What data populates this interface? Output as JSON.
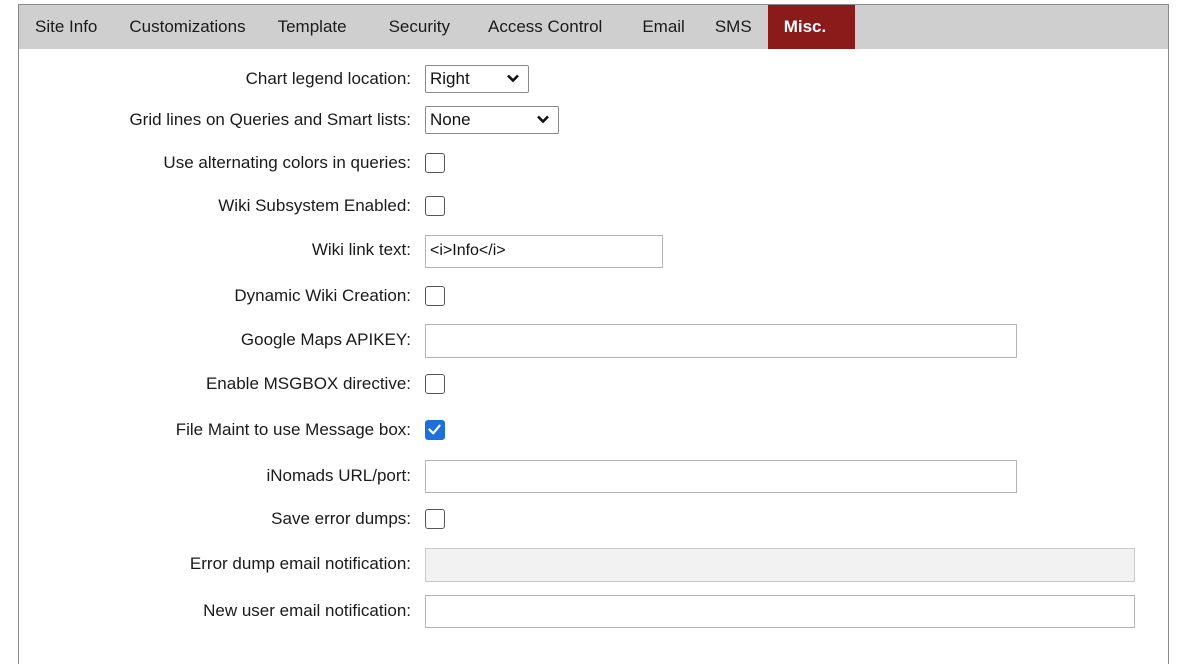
{
  "tabs": [
    {
      "label": "Site Info",
      "active": false
    },
    {
      "label": "Customizations",
      "active": false
    },
    {
      "label": "Template",
      "active": false
    },
    {
      "label": "Security",
      "active": false
    },
    {
      "label": "Access Control",
      "active": false
    },
    {
      "label": "Email",
      "active": false
    },
    {
      "label": "SMS",
      "active": false
    },
    {
      "label": "Misc.",
      "active": true
    }
  ],
  "colors": {
    "tab_bar": "#cfcfcf",
    "active_tab": "#8b1a1a",
    "checkbox_checked": "#1e6fd9"
  },
  "fields": {
    "chart_legend": {
      "label": "Chart legend location:",
      "value": "Right"
    },
    "grid_lines": {
      "label": "Grid lines on Queries and Smart lists:",
      "value": "None"
    },
    "alt_colors": {
      "label": "Use alternating colors in queries:",
      "checked": false
    },
    "wiki_enabled": {
      "label": "Wiki Subsystem Enabled:",
      "checked": false
    },
    "wiki_link_text": {
      "label": "Wiki link text:",
      "value": "<i>Info</i>"
    },
    "dynamic_wiki": {
      "label": "Dynamic Wiki Creation:",
      "checked": false
    },
    "google_maps": {
      "label": "Google Maps APIKEY:",
      "value": ""
    },
    "msgbox_directive": {
      "label": "Enable MSGBOX directive:",
      "checked": false
    },
    "file_maint_msgbox": {
      "label": "File Maint to use Message box:",
      "checked": true
    },
    "inomads_url": {
      "label": "iNomads URL/port:",
      "value": ""
    },
    "save_error_dumps": {
      "label": "Save error dumps:",
      "checked": false
    },
    "error_dump_email": {
      "label": "Error dump email notification:",
      "value": "",
      "disabled": true
    },
    "new_user_email": {
      "label": "New user email notification:",
      "value": ""
    }
  }
}
